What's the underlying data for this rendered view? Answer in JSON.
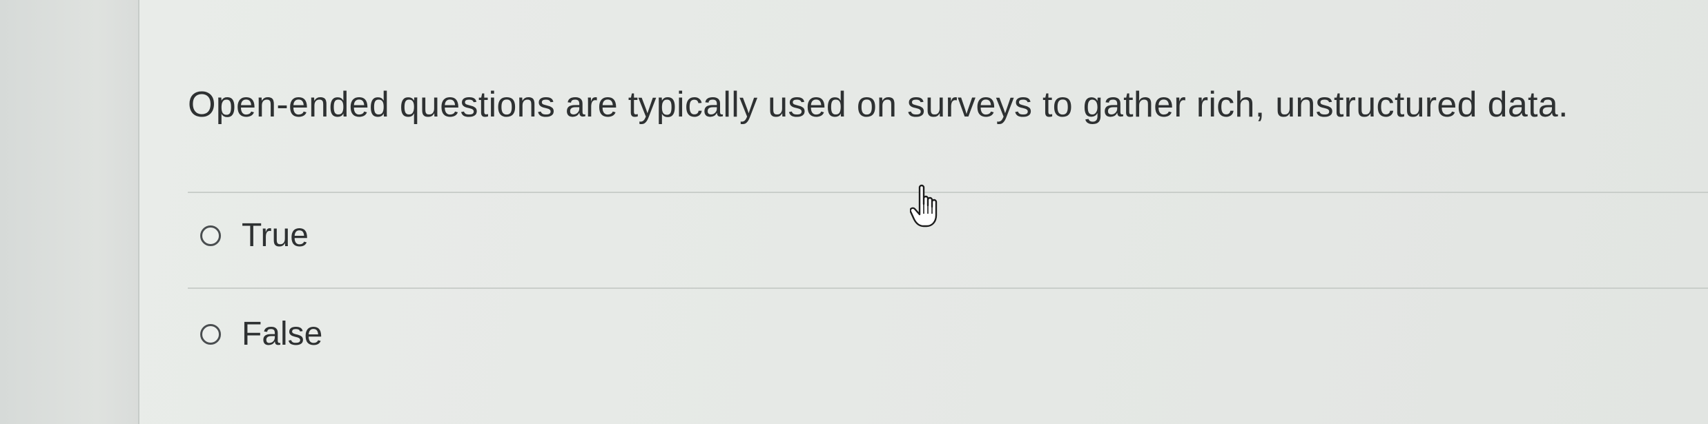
{
  "question": {
    "text": "Open-ended questions are typically used on surveys to gather rich, unstructured data."
  },
  "options": [
    {
      "label": "True",
      "selected": false
    },
    {
      "label": "False",
      "selected": false
    }
  ],
  "cursor": {
    "icon": "hand-pointer-icon"
  },
  "colors": {
    "background": "#e6e9e6",
    "text": "#2e3132",
    "divider": "#c9ceca"
  }
}
